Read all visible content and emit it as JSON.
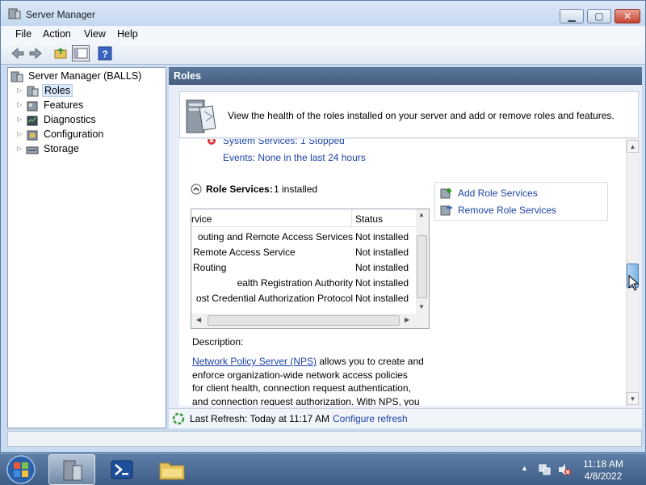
{
  "window": {
    "title": "Server Manager"
  },
  "menu": [
    "File",
    "Action",
    "View",
    "Help"
  ],
  "tree": {
    "root": "Server Manager (BALLS)",
    "items": [
      {
        "label": "Roles",
        "selected": true
      },
      {
        "label": "Features"
      },
      {
        "label": "Diagnostics"
      },
      {
        "label": "Configuration"
      },
      {
        "label": "Storage"
      }
    ]
  },
  "pane": {
    "header": "Roles",
    "banner_text": "View the health of the roles installed on your server and add or remove roles and features.",
    "system_services": "System Services: 1 Stopped",
    "events": "Events: None in the last 24 hours",
    "role_services_label": "Role Services:",
    "role_services_count": "1 installed",
    "actions": {
      "add": "Add Role Services",
      "remove": "Remove Role Services"
    },
    "table": {
      "columns": [
        "rvice",
        "Status"
      ],
      "rows": [
        {
          "name": "outing and Remote Access Services",
          "status": "Not installed"
        },
        {
          "name": "Remote Access Service",
          "status": "Not installed"
        },
        {
          "name": "Routing",
          "status": "Not installed"
        },
        {
          "name": "ealth Registration Authority",
          "status": "Not installed"
        },
        {
          "name": "ost Credential Authorization Protocol",
          "status": "Not installed"
        }
      ]
    },
    "description_label": "Description:",
    "description_link": "Network Policy Server (NPS)",
    "description_lines": [
      "allows you to create and",
      "enforce organization-wide network access policies",
      "for client health, connection request authentication,",
      "and connection request authorization. With NPS, you"
    ],
    "last_refresh": "Last Refresh: Today at 11:17 AM",
    "configure_refresh": "Configure refresh"
  },
  "taskbar": {
    "time": "11:18 AM",
    "date": "4/8/2022"
  },
  "colors": {
    "link": "#1d43a8",
    "header": "#4e6a90",
    "taskbar": "#4d6e98"
  }
}
